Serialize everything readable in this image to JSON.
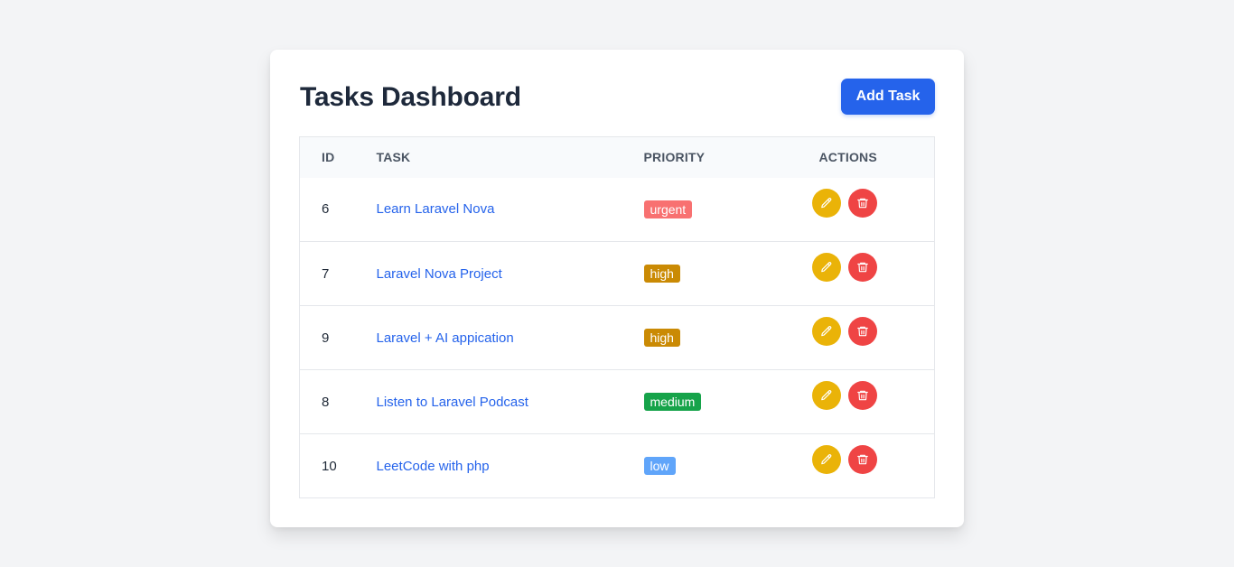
{
  "header": {
    "title": "Tasks Dashboard",
    "add_label": "Add Task"
  },
  "table": {
    "columns": {
      "id": "ID",
      "task": "TASK",
      "priority": "PRIORITY",
      "actions": "ACTIONS"
    },
    "rows": [
      {
        "id": "6",
        "task": "Learn Laravel Nova",
        "priority": "urgent",
        "priority_color": "#f87171"
      },
      {
        "id": "7",
        "task": "Laravel Nova Project",
        "priority": "high",
        "priority_color": "#ca8a04"
      },
      {
        "id": "9",
        "task": "Laravel + AI appication",
        "priority": "high",
        "priority_color": "#ca8a04"
      },
      {
        "id": "8",
        "task": "Listen to Laravel Podcast",
        "priority": "medium",
        "priority_color": "#16a34a"
      },
      {
        "id": "10",
        "task": "LeetCode with php",
        "priority": "low",
        "priority_color": "#60a5fa"
      }
    ]
  },
  "actions": {
    "edit_icon": "pencil-icon",
    "delete_icon": "trash-icon",
    "edit_color": "#eab308",
    "delete_color": "#ef4444"
  },
  "colors": {
    "accent": "#2563eb",
    "page_bg": "#f3f4f6"
  }
}
